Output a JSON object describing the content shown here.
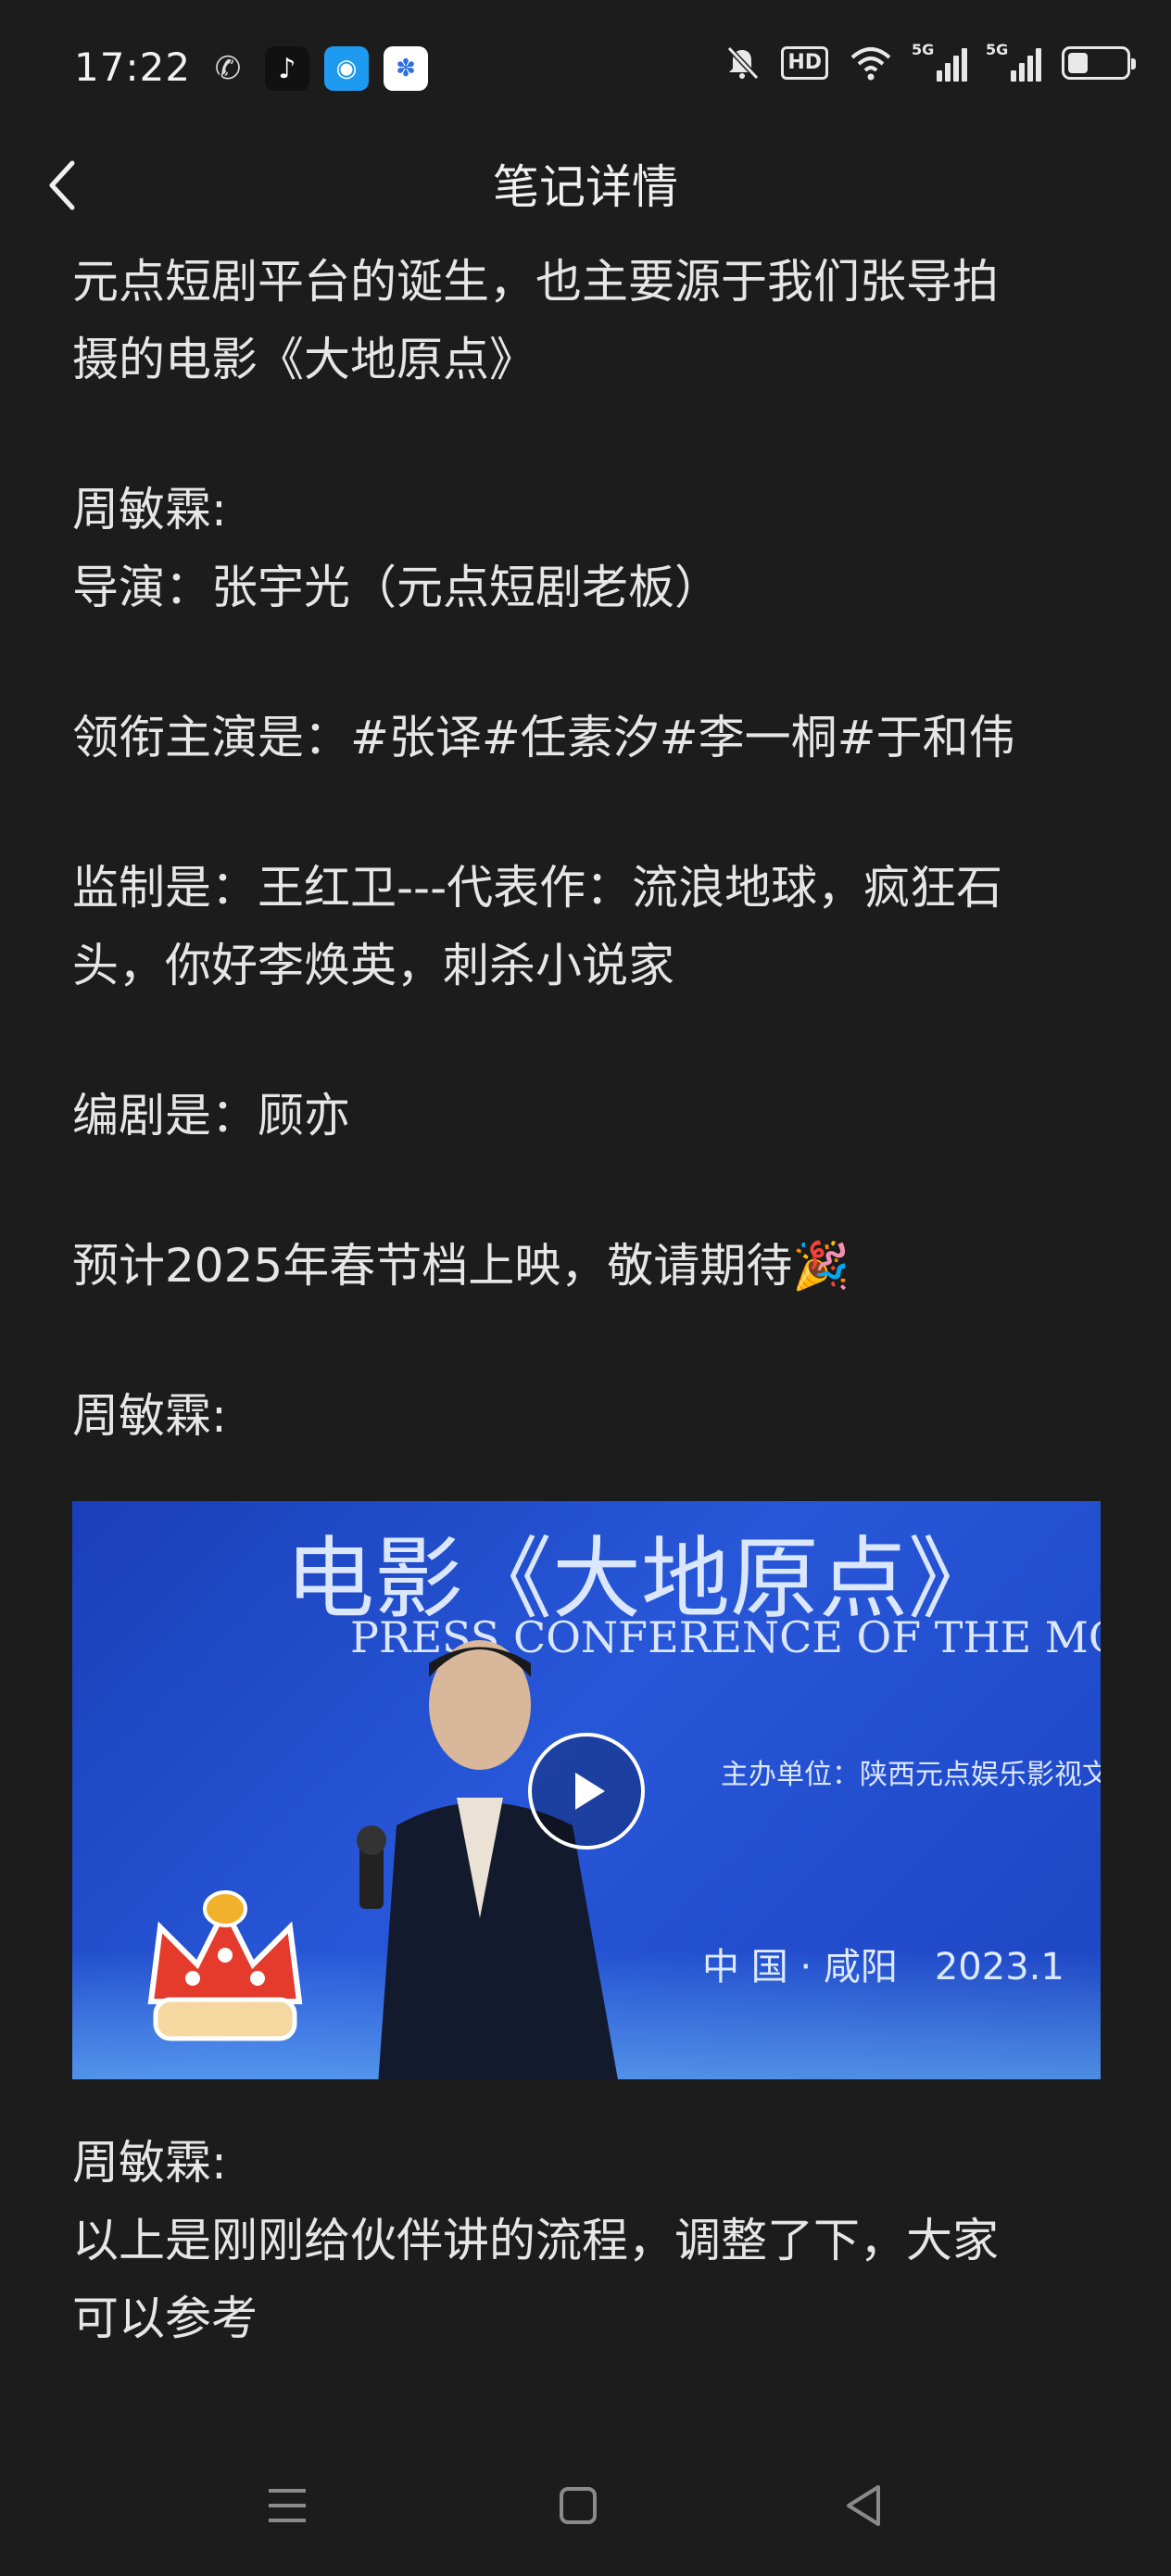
{
  "status_bar": {
    "time": "17:22",
    "app_icons": [
      "wechat-icon",
      "tiktok-icon",
      "chat-app-icon",
      "baidu-icon"
    ],
    "hd_label": "HD",
    "signal_label_1": "5G",
    "signal_label_2": "5G",
    "battery_level": 0.35
  },
  "header": {
    "title": "笔记详情"
  },
  "note": {
    "para1": "元点短剧平台的诞生，也主要源于我们张导拍\n摄的电影《大地原点》",
    "para2": "周敏霖:\n导演：张宇光（元点短剧老板）",
    "para3": "领衔主演是：#张译#任素汐#李一桐#于和伟",
    "para4": "监制是：王红卫---代表作：流浪地球，疯狂石\n头，你好李焕英，刺杀小说家",
    "para5": "编剧是：顾亦",
    "para6": "预计2025年春节档上映，敬请期待🎉",
    "para7": "周敏霖:",
    "para8": "周敏霖:\n以上是刚刚给伙伴讲的流程，调整了下，大家\n可以参考"
  },
  "video": {
    "banner_title": "电影《大地原点》",
    "banner_sub": "PRESS CONFERENCE OF THE MOV",
    "banner_org": "主办单位：陕西元点娱乐影视文",
    "banner_city": "中 国 · 咸阳　2023.1"
  },
  "colors": {
    "background": "#1c1c1c",
    "text": "#e6e6e6",
    "video_blue": "#2757d8"
  }
}
